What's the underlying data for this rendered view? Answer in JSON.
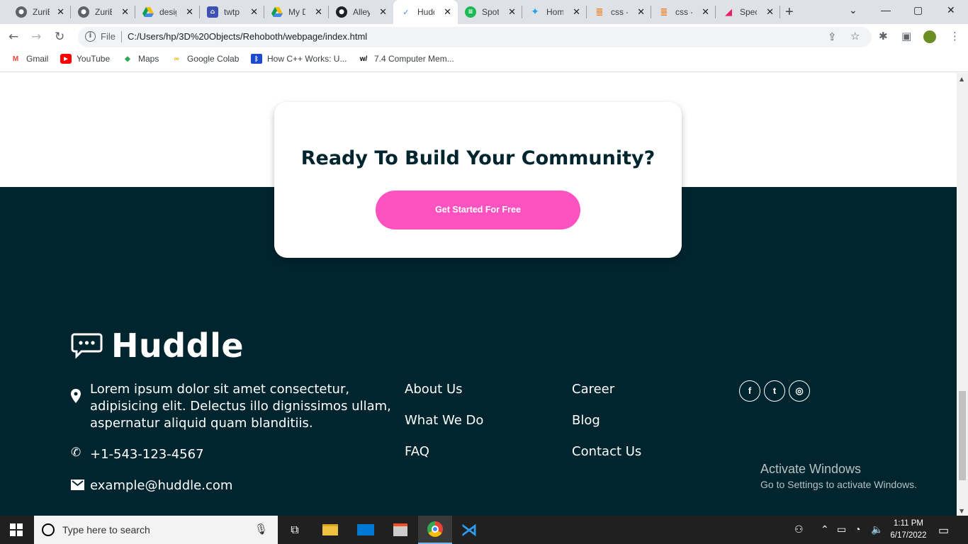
{
  "browser": {
    "tabs": [
      {
        "title": "ZuriB",
        "icon": "github-icon",
        "active": false
      },
      {
        "title": "ZuriB",
        "icon": "github-icon",
        "active": false
      },
      {
        "title": "desig",
        "icon": "google-drive-icon",
        "active": false
      },
      {
        "title": "twtp",
        "icon": "site-icon",
        "active": false
      },
      {
        "title": "My D",
        "icon": "google-drive-icon",
        "active": false
      },
      {
        "title": "Alley",
        "icon": "github-icon",
        "active": false
      },
      {
        "title": "Hudd",
        "icon": "huddle-icon",
        "active": true
      },
      {
        "title": "Spoti",
        "icon": "spotify-icon",
        "active": false
      },
      {
        "title": "Hom",
        "icon": "twitter-icon",
        "active": false
      },
      {
        "title": "css -",
        "icon": "stackoverflow-icon",
        "active": false
      },
      {
        "title": "css -",
        "icon": "stackoverflow-icon",
        "active": false
      },
      {
        "title": "Spec",
        "icon": "brush-icon",
        "active": false
      }
    ],
    "new_tab": "+",
    "controls": {
      "dropdown": "⌄",
      "minimize": "—",
      "maximize": "▢",
      "close": "✕"
    },
    "nav": {
      "back": "←",
      "forward": "→",
      "reload": "↻"
    },
    "address": {
      "scheme_label": "File",
      "url": "C:/Users/hp/3D%20Objects/Rehoboth/webpage/index.html"
    },
    "bookmarks": [
      {
        "label": "Gmail",
        "icon": "gmail-icon"
      },
      {
        "label": "YouTube",
        "icon": "youtube-icon"
      },
      {
        "label": "Maps",
        "icon": "maps-icon"
      },
      {
        "label": "Google Colab",
        "icon": "colab-icon"
      },
      {
        "label": "How C++ Works: U...",
        "icon": "site-icon"
      },
      {
        "label": "7.4 Computer Mem...",
        "icon": "site-icon"
      }
    ]
  },
  "page": {
    "cta": {
      "heading": "Ready To Build Your Community?",
      "button": "Get Started For Free"
    },
    "footer": {
      "brand": "Huddle",
      "address": [
        "Lorem ipsum dolor sit amet consectetur,",
        "adipisicing elit. Delectus illo dignissimos ullam,",
        "aspernatur aliquid quam blanditiis."
      ],
      "phone": "+1-543-123-4567",
      "email": "example@huddle.com",
      "links_col1": [
        "About Us",
        "What We Do",
        "FAQ"
      ],
      "links_col2": [
        "Career",
        "Blog",
        "Contact Us"
      ],
      "social": [
        {
          "name": "facebook-icon",
          "glyph": "f"
        },
        {
          "name": "twitter-icon",
          "glyph": "t"
        },
        {
          "name": "instagram-icon",
          "glyph": "◎"
        }
      ]
    },
    "watermark": {
      "line1": "Activate Windows",
      "line2": "Go to Settings to activate Windows."
    }
  },
  "taskbar": {
    "search_placeholder": "Type here to search",
    "time": "1:11 PM",
    "date": "6/17/2022"
  },
  "colors": {
    "accent_pink": "#ff52c1",
    "footer_bg": "#00252e"
  }
}
